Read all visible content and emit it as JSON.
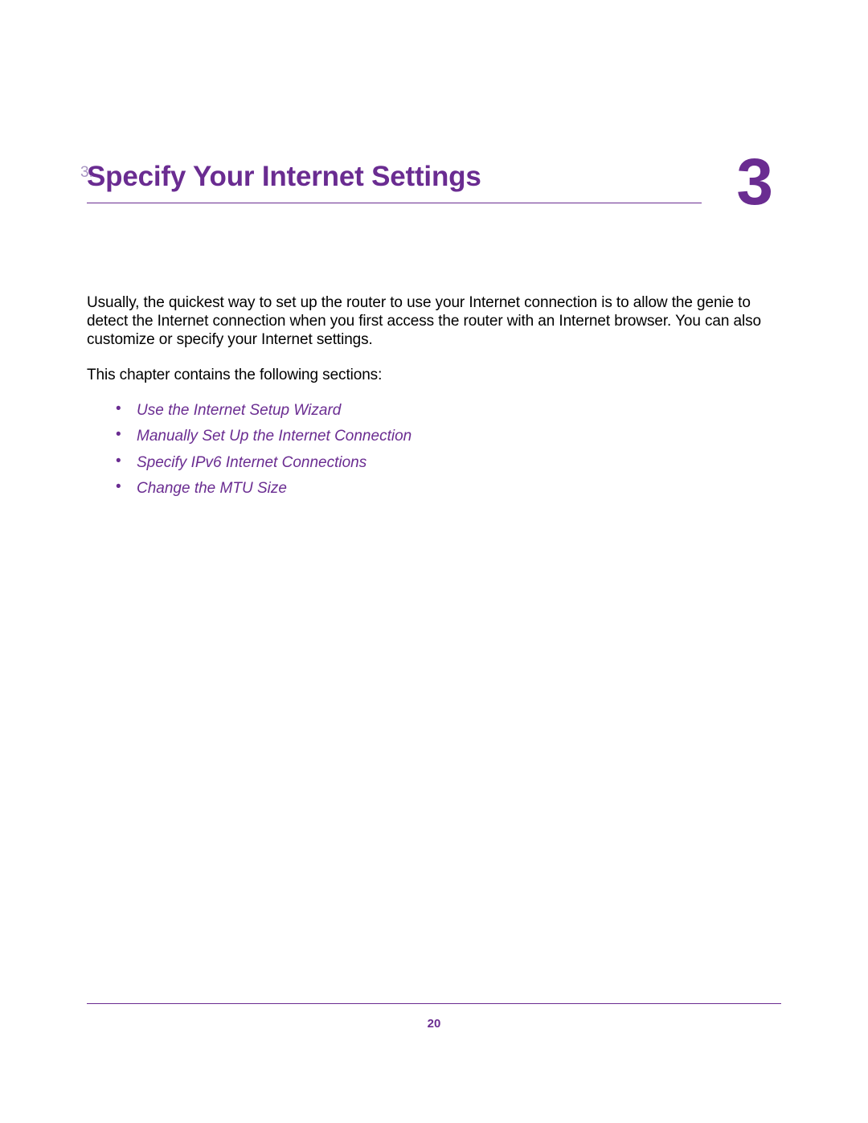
{
  "chapter": {
    "marker": "3.",
    "title": "Specify Your Internet Settings",
    "number": "3"
  },
  "body": {
    "p1": "Usually, the quickest way to set up the router to use your Internet connection is to allow the genie to detect the Internet connection when you first access the router with an Internet browser. You can also customize or specify your Internet settings.",
    "p2": "This chapter contains the following sections:"
  },
  "sections": {
    "items": [
      {
        "label": "Use the Internet Setup Wizard"
      },
      {
        "label": "Manually Set Up the Internet Connection"
      },
      {
        "label": "Specify IPv6 Internet Connections"
      },
      {
        "label": "Change the MTU Size"
      }
    ]
  },
  "footer": {
    "page_number": "20"
  }
}
